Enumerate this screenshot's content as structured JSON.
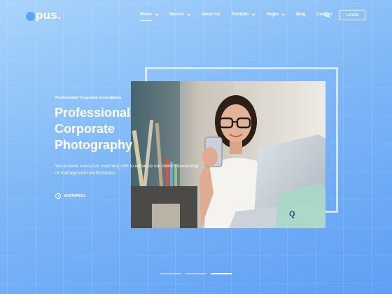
{
  "brand": {
    "logo_text": "pus."
  },
  "nav": {
    "items": [
      {
        "label": "Home",
        "dropdown": true,
        "active": true
      },
      {
        "label": "Service",
        "dropdown": true
      },
      {
        "label": "About Us",
        "dropdown": false
      },
      {
        "label": "Portfolio",
        "dropdown": true
      },
      {
        "label": "Pages",
        "dropdown": true
      },
      {
        "label": "Blog",
        "dropdown": false
      },
      {
        "label": "Contact",
        "dropdown": false
      }
    ],
    "search_icon": "search-icon",
    "login_label": "LOGIN"
  },
  "hero": {
    "eyebrow": "Professional Corporate Consultants",
    "headline": [
      "Professional",
      "Corporate",
      "Photography"
    ],
    "description": "We provide executive coaching with to enhance our client's leadership or management performance.",
    "showreel_label": "SHOWREEL",
    "photo_alt": "Woman with glasses smiling at phone in front of laptop"
  },
  "slider": {
    "count": 3,
    "active_index": 2
  },
  "colors": {
    "bg_start": "#a9d4fb",
    "bg_end": "#5e9ff5",
    "accent": "#5aa6f5"
  }
}
